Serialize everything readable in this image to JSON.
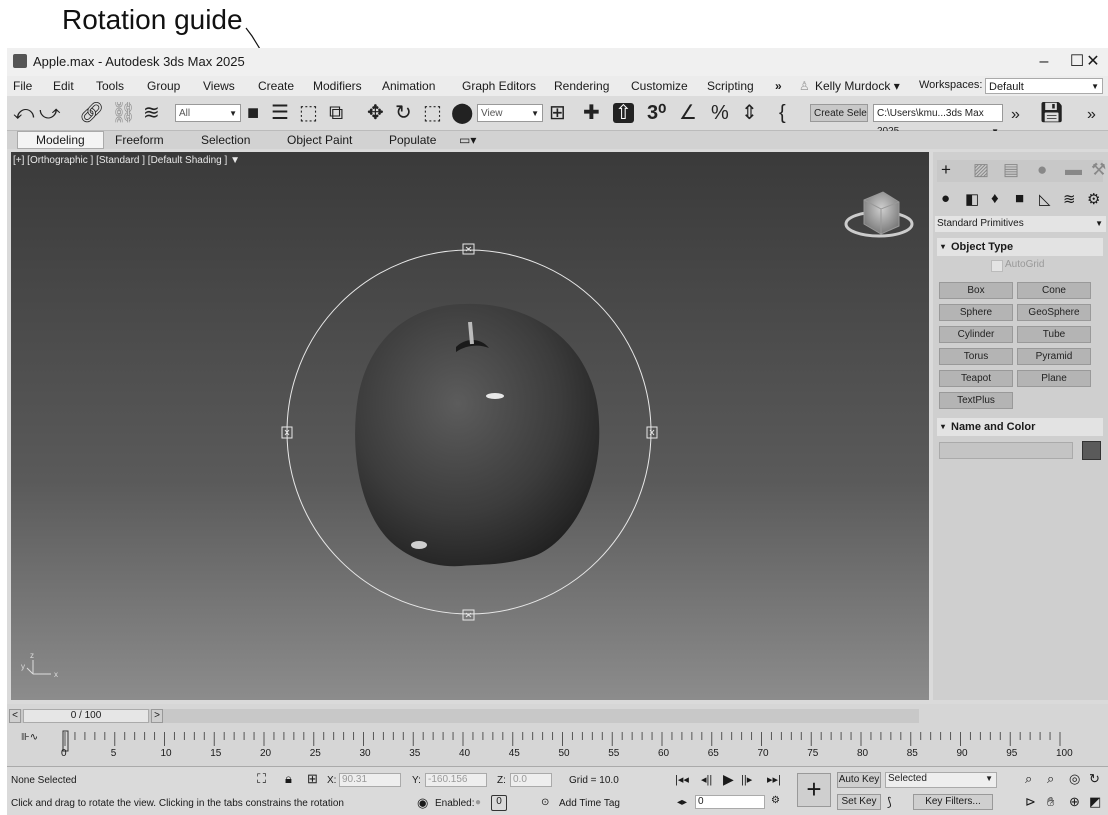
{
  "caption": "Rotation guide",
  "window": {
    "title": "Apple.max - Autodesk 3ds Max 2025",
    "minimize": "–",
    "maximize": "☐",
    "close": "✕"
  },
  "menu": [
    "File",
    "Edit",
    "Tools",
    "Group",
    "Views",
    "Create",
    "Modifiers",
    "Animation",
    "Graph Editors",
    "Rendering",
    "Customize",
    "Scripting"
  ],
  "menu_more": "»",
  "user": "Kelly Murdock",
  "workspaces_label": "Workspaces:",
  "workspace_value": "Default",
  "toolbar": {
    "selection_filter": "All",
    "ref_coord": "View",
    "create_sel": "Create Sele",
    "project_path": "C:\\Users\\kmu...3ds Max 2025"
  },
  "ribbon_tabs": [
    "Modeling",
    "Freeform",
    "Selection",
    "Object Paint",
    "Populate"
  ],
  "viewport": {
    "label": "[+] [Orthographic ] [Standard ] [Default Shading ]"
  },
  "command_panel": {
    "category": "Standard Primitives",
    "object_type_title": "Object Type",
    "autogrid": "AutoGrid",
    "buttons": [
      "Box",
      "Cone",
      "Sphere",
      "GeoSphere",
      "Cylinder",
      "Tube",
      "Torus",
      "Pyramid",
      "Teapot",
      "Plane",
      "TextPlus"
    ],
    "name_color_title": "Name and Color",
    "object_color": "#5a5a5a"
  },
  "timeline": {
    "frame_display": "0 / 100",
    "prev": "<",
    "next": ">",
    "ticks": [
      "0",
      "5",
      "10",
      "15",
      "20",
      "25",
      "30",
      "35",
      "40",
      "45",
      "50",
      "55",
      "60",
      "65",
      "70",
      "75",
      "80",
      "85",
      "90",
      "95",
      "100"
    ]
  },
  "status": {
    "selection": "None Selected",
    "prompt": "Click and drag to rotate the view.  Clicking in the tabs constrains the rotation",
    "x_label": "X:",
    "x_value": "90.31",
    "y_label": "Y:",
    "y_value": "-160.156",
    "z_label": "Z:",
    "z_value": "0.0",
    "grid": "Grid = 10.0",
    "enabled_label": "Enabled:",
    "add_time_tag": "Add Time Tag",
    "current_frame": "0",
    "auto_key": "Auto Key",
    "set_key": "Set Key",
    "key_mode": "Selected",
    "key_filters": "Key Filters..."
  }
}
